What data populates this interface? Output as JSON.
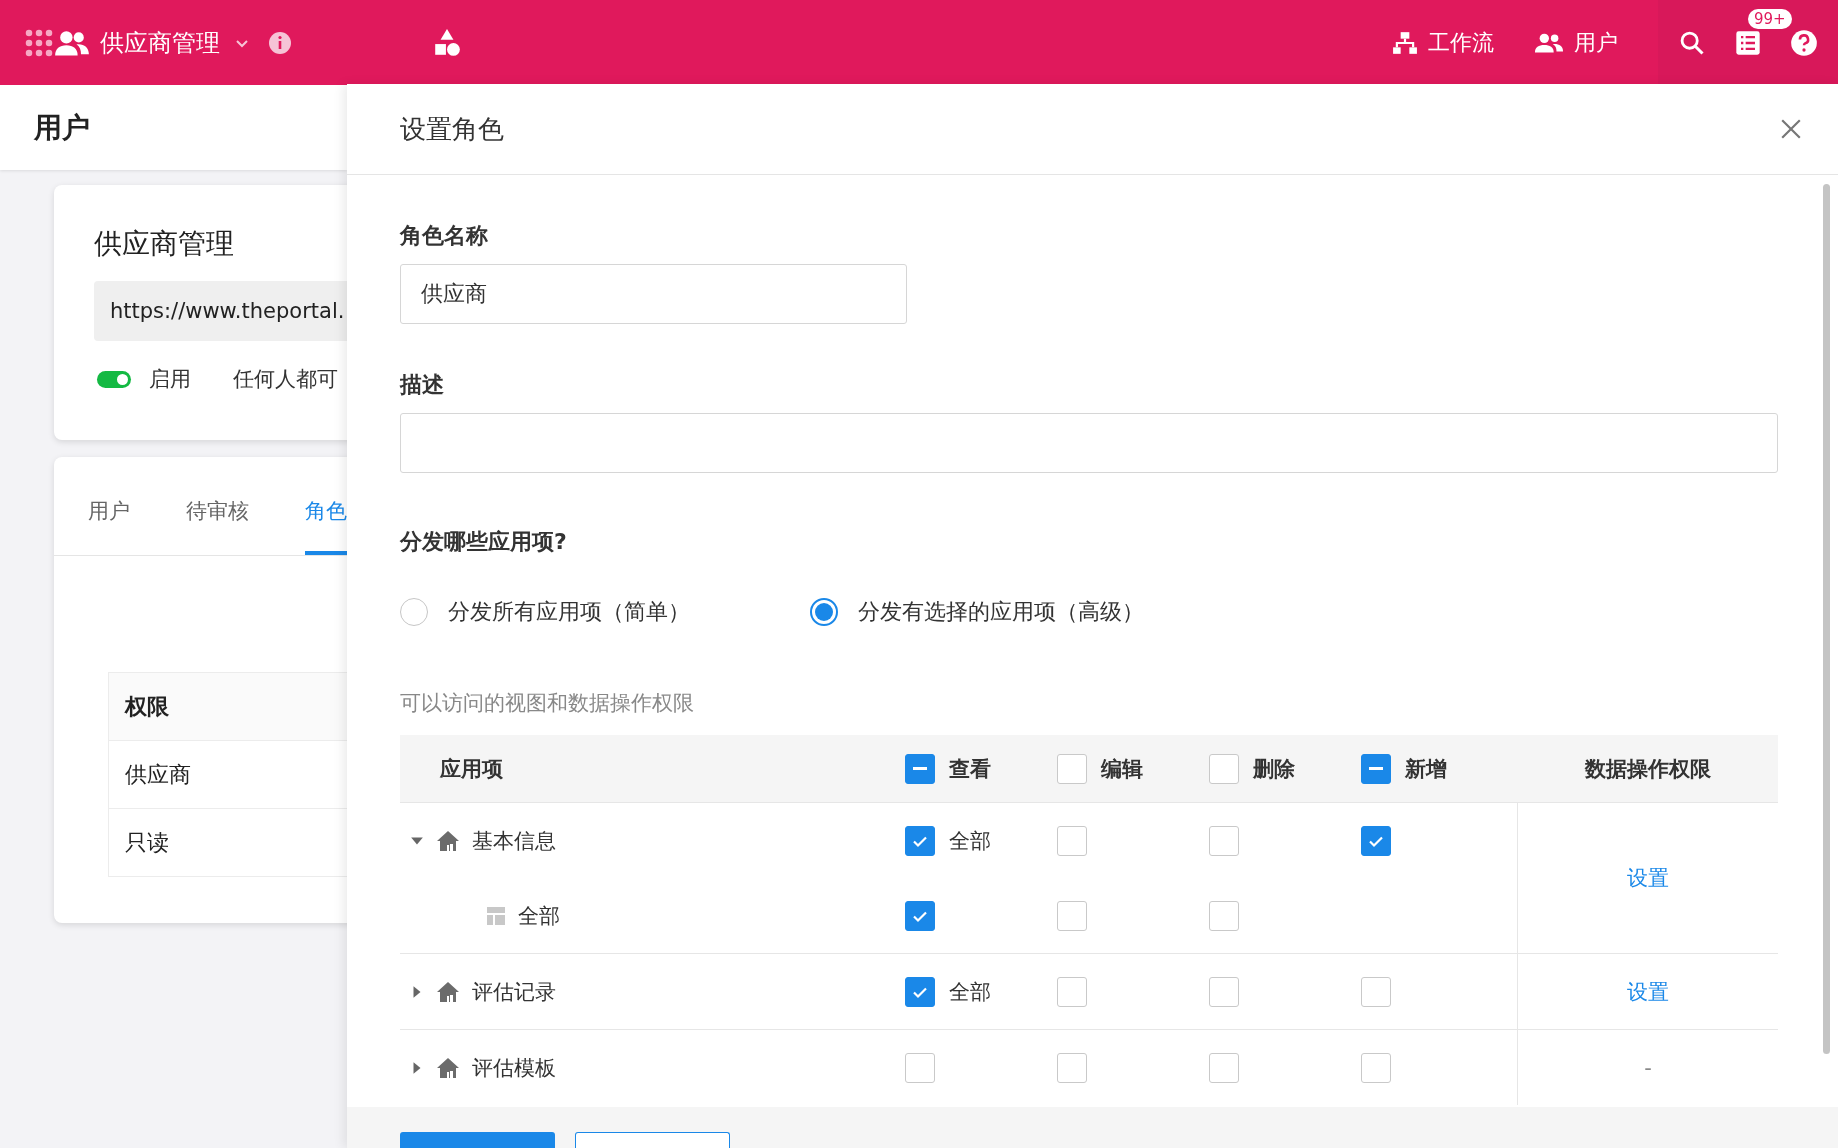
{
  "topbar": {
    "app_title": "供应商管理",
    "links": [
      {
        "label": "工作流"
      },
      {
        "label": "用户"
      }
    ],
    "badge": "99+"
  },
  "left": {
    "page_title": "用户",
    "portal": {
      "title": "供应商管理",
      "url": "https://www.theportal.",
      "enabled": true,
      "status_label": "启用",
      "access_text": "任何人都可"
    },
    "tabs": [
      {
        "label": "用户",
        "selected": false
      },
      {
        "label": "待审核",
        "selected": false
      },
      {
        "label": "角色",
        "selected": true
      }
    ],
    "table": {
      "header": "权限",
      "rows": [
        "供应商",
        "只读"
      ]
    }
  },
  "dialog": {
    "title": "设置角色",
    "name_label": "角色名称",
    "name_value": "供应商",
    "description_label": "描述",
    "question": "分发哪些应用项?",
    "options": [
      {
        "label": "分发所有应用项（简单）",
        "selected": false
      },
      {
        "label": "分发有选择的应用项（高级）",
        "selected": true
      }
    ],
    "permissions_caption": "可以访问的视图和数据操作权限",
    "table": {
      "item_header": "应用项",
      "columns": [
        {
          "label": "查看",
          "indeterminate": true
        },
        {
          "label": "编辑",
          "indeterminate": false
        },
        {
          "label": "删除",
          "indeterminate": false
        },
        {
          "label": "新增",
          "indeterminate": true
        }
      ],
      "data_header": "数据操作权限",
      "groups": [
        {
          "name": "基本信息",
          "kind": "module",
          "expanded": true,
          "perms": [
            {
              "checked": true,
              "label": "全部"
            },
            {
              "checked": false
            },
            {
              "checked": false
            },
            {
              "checked": true
            }
          ],
          "data_action": "设置",
          "link": true,
          "children": [
            {
              "name": "全部",
              "kind": "table",
              "perms": [
                {
                  "checked": true
                },
                {
                  "checked": false
                },
                {
                  "checked": false
                }
              ]
            }
          ]
        },
        {
          "name": "评估记录",
          "kind": "module",
          "expanded": false,
          "perms": [
            {
              "checked": true,
              "label": "全部"
            },
            {
              "checked": false
            },
            {
              "checked": false
            },
            {
              "checked": false
            }
          ],
          "data_action": "设置",
          "link": true
        },
        {
          "name": "评估模板",
          "kind": "module",
          "expanded": false,
          "perms": [
            {
              "checked": false
            },
            {
              "checked": false
            },
            {
              "checked": false
            },
            {
              "checked": false
            }
          ],
          "data_action": "-",
          "link": false
        }
      ]
    }
  }
}
